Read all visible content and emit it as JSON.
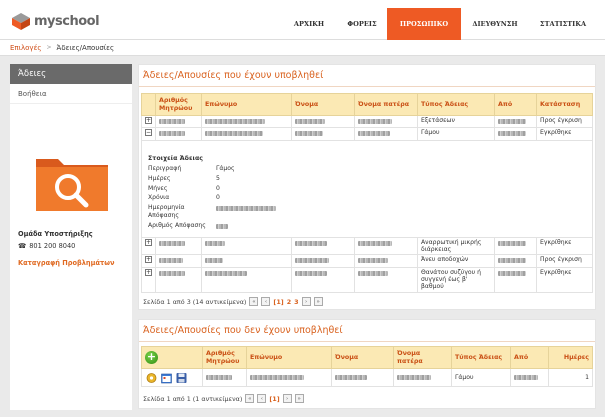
{
  "app": {
    "logo_text": "myschool",
    "colors": {
      "accent": "#ee5a24",
      "header_bg": "#fbe9b4",
      "header_text": "#c94f14"
    }
  },
  "nav": [
    {
      "label": "ΑΡΧΙΚΗ",
      "active": false
    },
    {
      "label": "ΦΟΡΕΙΣ",
      "active": false
    },
    {
      "label": "ΠΡΟΣΩΠΙΚΟ",
      "active": true
    },
    {
      "label": "ΔΙΕΥΘΥΝΣΗ",
      "active": false
    },
    {
      "label": "ΣΤΑΤΙΣΤΙΚΑ",
      "active": false
    }
  ],
  "breadcrumb": {
    "link": "Επιλογές",
    "separator": ">",
    "current": "Άδειες/Απουσίες"
  },
  "sidebar": {
    "title": "Άδειες",
    "items": [
      {
        "label": "Βοήθεια"
      }
    ],
    "support_title": "Ομάδα Υποστήριξης",
    "support_phone": "801 200 8040",
    "support_link": "Καταγραφή Προβλημάτων"
  },
  "submitted": {
    "title": "Άδειες/Απουσίες που έχουν υποβληθεί",
    "columns": [
      "",
      "Αριθμός Μητρώου",
      "Επώνυμο",
      "Όνομα",
      "Όνομα πατέρα",
      "Τύπος Άδειας",
      "Από",
      "Κατάσταση"
    ],
    "rows_top": [
      {
        "expander": "+",
        "type": "Εξετάσεων",
        "status": "Προς έγκριση"
      },
      {
        "expander": "−",
        "type": "Γάμου",
        "status": "Εγκρίθηκε"
      }
    ],
    "details": {
      "title": "Στοιχεία Άδειας",
      "fields": [
        {
          "label": "Περιγραφή",
          "value": "Γάμος"
        },
        {
          "label": "Ημέρες",
          "value": "5"
        },
        {
          "label": "Μήνες",
          "value": "0"
        },
        {
          "label": "Χρόνια",
          "value": "0"
        },
        {
          "label": "Ημερομηνία Απόφασης",
          "value": ""
        },
        {
          "label": "Αριθμός Απόφασης",
          "value": ""
        }
      ]
    },
    "rows_bottom": [
      {
        "expander": "+",
        "type": "Αναρρωτική μικρής διάρκειας",
        "status": "Εγκρίθηκε"
      },
      {
        "expander": "+",
        "type": "Άνευ αποδοχών",
        "status": "Προς έγκριση"
      },
      {
        "expander": "+",
        "type": "Θανάτου συζύγου ή συγγενή έως β' βαθμού",
        "status": "Εγκρίθηκε"
      }
    ],
    "pager": {
      "text": "Σελίδα 1 από 3 (14 αντικείμενα)",
      "current": "[1]",
      "pages": [
        "2",
        "3"
      ]
    }
  },
  "unsubmitted": {
    "title": "Άδειες/Απουσίες που δεν έχουν υποβληθεί",
    "columns": [
      "",
      "Αριθμός Μητρώου",
      "Επώνυμο",
      "Όνομα",
      "Όνομα πατέρα",
      "Τύπος Άδειας",
      "Από",
      "Ημέρες"
    ],
    "rows": [
      {
        "type": "Γάμου",
        "days": "1"
      }
    ],
    "pager": {
      "text": "Σελίδα 1 από 1 (1 αντικείμενα)",
      "current": "[1]"
    }
  }
}
